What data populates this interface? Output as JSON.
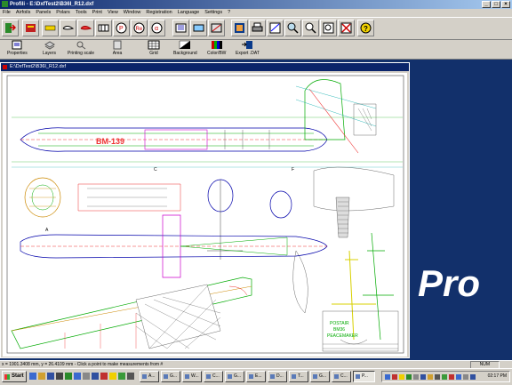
{
  "window": {
    "title": "Profili - E:\\DxfTest2\\B36I_R12.dxf"
  },
  "menu": [
    "File",
    "Airfoils",
    "Panels",
    "Polars",
    "Tools",
    "Print",
    "View",
    "Window",
    "Registration",
    "Language",
    "Settings",
    "?"
  ],
  "toolbar2": [
    {
      "label": "Properties"
    },
    {
      "label": "Layers"
    },
    {
      "label": "Printing scale"
    },
    {
      "label": "Area"
    },
    {
      "label": "Grid"
    },
    {
      "label": "Background"
    },
    {
      "label": "Color/BW"
    },
    {
      "label": "Export .DAT"
    }
  ],
  "document": {
    "title": "E:\\DxfTest2\\B36I_R12.dxf"
  },
  "drawing_text": {
    "reg": "BM-139",
    "label_a": "A",
    "label_c": "C",
    "label_f": "F",
    "brand1": "POSTAIR",
    "brand2": "BM36",
    "brand3": "PEACEMAKER"
  },
  "overlay": {
    "text": "Pro"
  },
  "status": {
    "coords": "x = 1901.3408 mm, y = 26.4109 mm - Click a point to make measurements from #",
    "num": "NUM"
  },
  "taskbar": {
    "start": "Start",
    "tasks": [
      "A...",
      "G...",
      "W...",
      "C...",
      "G...",
      "E...",
      "D...",
      "T...",
      "G...",
      "C...",
      "P..."
    ],
    "clock": "02:17 PM"
  }
}
